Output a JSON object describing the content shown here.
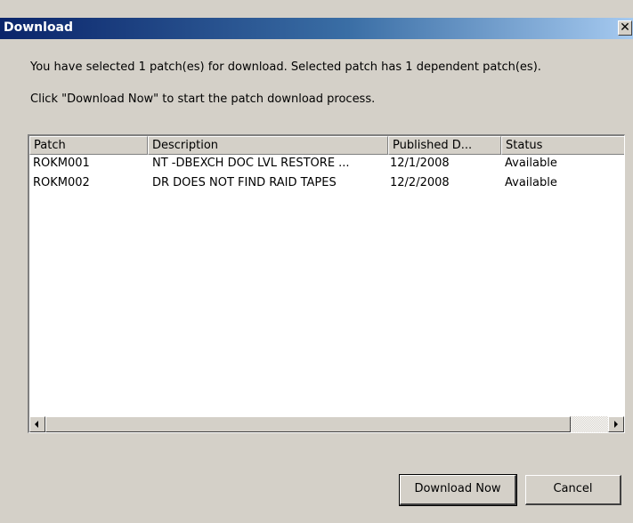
{
  "window": {
    "title": "Download",
    "close_glyph": "✕"
  },
  "message": {
    "line1": "You have selected 1 patch(es) for download. Selected patch has 1 dependent patch(es).",
    "line2": "Click \"Download Now\" to start the patch download process."
  },
  "table": {
    "columns": [
      "Patch",
      "Description",
      "Published D...",
      "Status"
    ],
    "rows": [
      [
        "ROKM001",
        "NT -DBEXCH DOC LVL RESTORE ...",
        "12/1/2008",
        "Available"
      ],
      [
        "ROKM002",
        "DR DOES NOT FIND RAID TAPES",
        "12/2/2008",
        "Available"
      ]
    ]
  },
  "buttons": {
    "download_now": "Download Now",
    "cancel": "Cancel"
  },
  "icons": {
    "close": "close-icon",
    "scroll_left": "arrow-left-icon",
    "scroll_right": "arrow-right-icon"
  }
}
